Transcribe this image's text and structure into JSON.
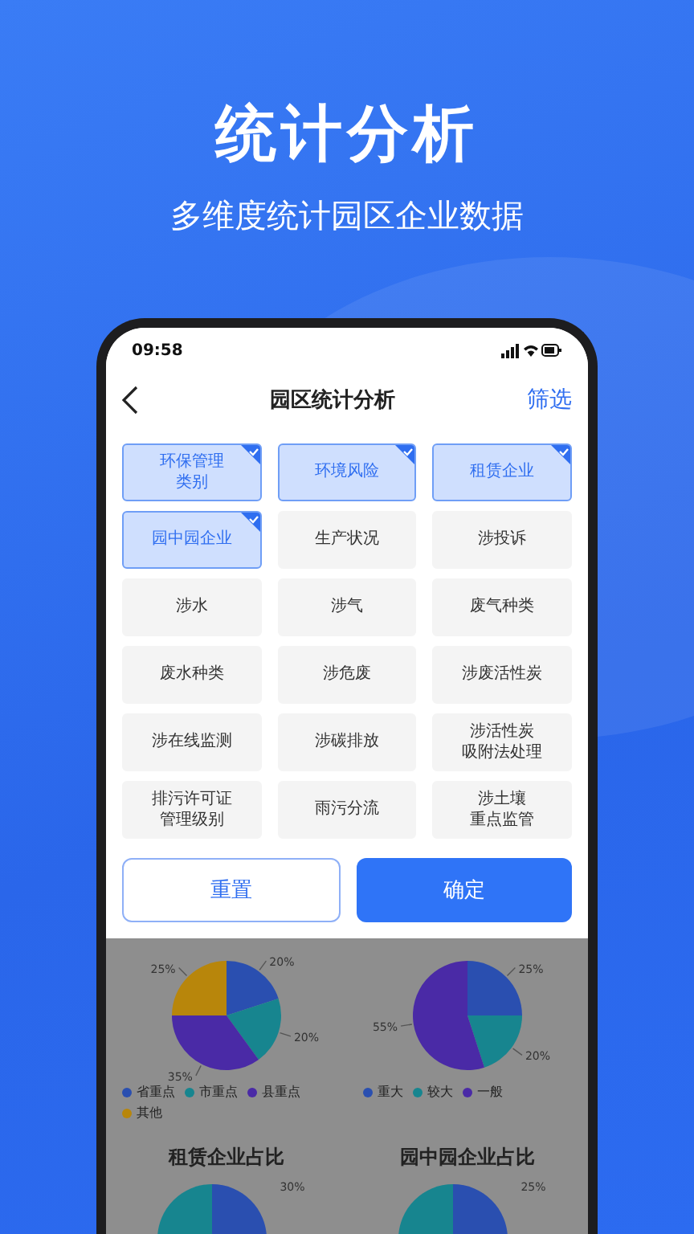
{
  "promo": {
    "title": "统计分析",
    "subtitle": "多维度统计园区企业数据"
  },
  "status_bar": {
    "time": "09:58"
  },
  "nav": {
    "title": "园区统计分析",
    "action": "筛选"
  },
  "filters": [
    {
      "lines": [
        "环保管理",
        "类别"
      ],
      "selected": true
    },
    {
      "lines": [
        "环境风险"
      ],
      "selected": true
    },
    {
      "lines": [
        "租赁企业"
      ],
      "selected": true
    },
    {
      "lines": [
        "园中园企业"
      ],
      "selected": true
    },
    {
      "lines": [
        "生产状况"
      ],
      "selected": false
    },
    {
      "lines": [
        "涉投诉"
      ],
      "selected": false
    },
    {
      "lines": [
        "涉水"
      ],
      "selected": false
    },
    {
      "lines": [
        "涉气"
      ],
      "selected": false
    },
    {
      "lines": [
        "废气种类"
      ],
      "selected": false
    },
    {
      "lines": [
        "废水种类"
      ],
      "selected": false
    },
    {
      "lines": [
        "涉危废"
      ],
      "selected": false
    },
    {
      "lines": [
        "涉废活性炭"
      ],
      "selected": false
    },
    {
      "lines": [
        "涉在线监测"
      ],
      "selected": false
    },
    {
      "lines": [
        "涉碳排放"
      ],
      "selected": false
    },
    {
      "lines": [
        "涉活性炭",
        "吸附法处理"
      ],
      "selected": false
    },
    {
      "lines": [
        "排污许可证",
        "管理级别"
      ],
      "selected": false
    },
    {
      "lines": [
        "雨污分流"
      ],
      "selected": false
    },
    {
      "lines": [
        "涉土壤",
        "重点监管"
      ],
      "selected": false
    }
  ],
  "buttons": {
    "reset": "重置",
    "confirm": "确定"
  },
  "charts": [
    {
      "chart_data": {
        "type": "pie",
        "categories": [
          "省重点",
          "市重点",
          "县重点",
          "其他"
        ],
        "values": [
          20,
          20,
          35,
          25
        ],
        "colors": [
          "#2a4fb0",
          "#17858f",
          "#4a2aa6",
          "#b8860b"
        ],
        "value_labels": [
          "20%",
          "20%",
          "35%",
          "25%"
        ],
        "legend": "bottom"
      }
    },
    {
      "chart_data": {
        "type": "pie",
        "categories": [
          "重大",
          "较大",
          "一般"
        ],
        "values": [
          25,
          20,
          55
        ],
        "colors": [
          "#2a4fb0",
          "#17858f",
          "#4a2aa6"
        ],
        "value_labels": [
          "25%",
          "20%",
          "55%"
        ],
        "legend": "bottom"
      }
    }
  ],
  "lower_charts": [
    {
      "title": "租赁企业占比",
      "label": "30%"
    },
    {
      "title": "园中园企业占比",
      "label": "25%"
    }
  ]
}
